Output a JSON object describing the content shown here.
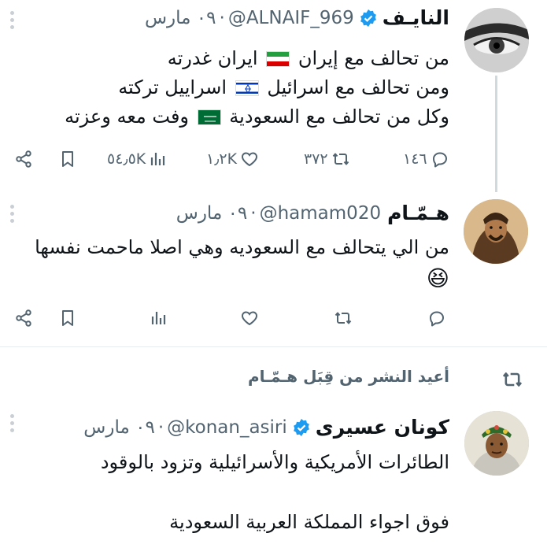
{
  "tweets": [
    {
      "name": "النايـف",
      "handle": "@ALNAIF_969",
      "dot": "·",
      "date": "٠٩ مارس",
      "lines": [
        {
          "text": "من تحالف مع إيران",
          "flag": "iran",
          "after": "ايران غدرته"
        },
        {
          "text": "ومن تحالف مع اسرائيل",
          "flag": "israel",
          "after": "اسراييل تركته"
        },
        {
          "text": "وكل من تحالف مع السعودية",
          "flag": "saudi",
          "after": "وفت معه وعزته"
        }
      ],
      "counts": {
        "replies": "١٤٦",
        "retweets": "٣٧٢",
        "likes": "١٫٢K",
        "views": "٥٤٫٥K"
      }
    },
    {
      "name": "هـمّـام",
      "handle": "@hamam020",
      "dot": "·",
      "date": "٠٩ مارس",
      "lines": [
        "من الي يتحالف مع  السعوديه وهي اصلا ماحمت نفسها",
        "😆"
      ],
      "counts": {
        "replies": "",
        "retweets": "",
        "likes": "",
        "views": ""
      }
    },
    {
      "repost_label": "أعيد النشر من قِبَل هـمّـام",
      "name": "كونان عسيرى",
      "handle": "@konan_asiri",
      "dot": "·",
      "date": "٠٩ مارس",
      "lines": [
        "الطائرات الأمريكية والأسرائيلية وتزود بالوقود",
        "",
        "فوق اجواء المملكة العربية السعودية"
      ]
    }
  ],
  "colors": {
    "accent": "#1d9bf0",
    "muted": "#536471",
    "text": "#0f1419",
    "divider": "#e6ecf0"
  },
  "icons": [
    "share-icon",
    "bookmark-icon",
    "views-icon",
    "like-icon",
    "retweet-icon",
    "reply-icon",
    "verified-icon",
    "more-icon"
  ]
}
